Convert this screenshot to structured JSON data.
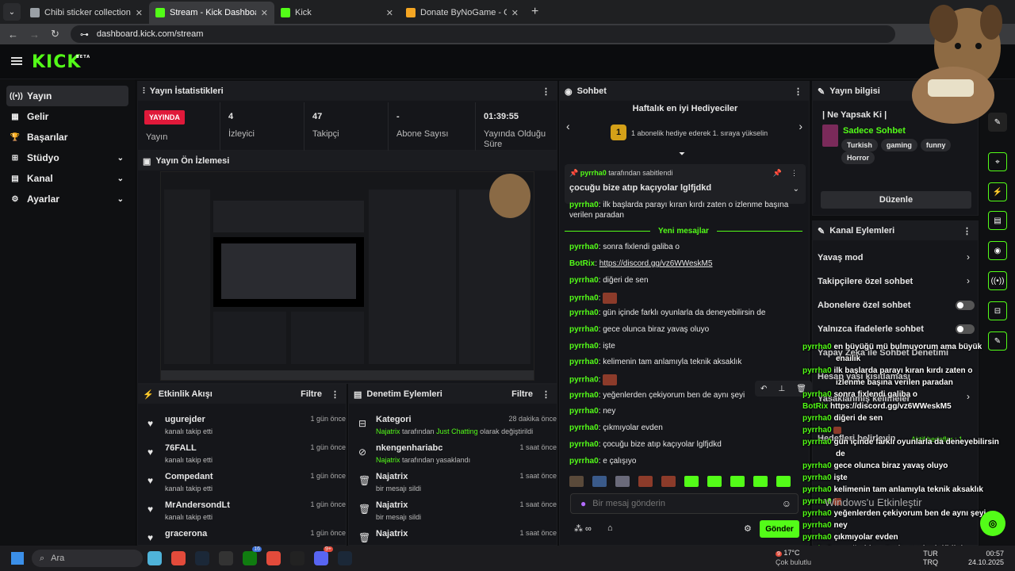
{
  "browser": {
    "tabs": [
      {
        "title": "Chibi sticker collection",
        "color": "#9aa0a6"
      },
      {
        "title": "Stream - Kick Dashboard",
        "color": "#53fc18"
      },
      {
        "title": "Kick",
        "color": "#53fc18"
      },
      {
        "title": "Donate ByNoGame - Gelen/Gid",
        "color": "#f5a623"
      }
    ],
    "url": "dashboard.kick.com/stream"
  },
  "nav": {
    "logo": "KICK",
    "beta": "BETA"
  },
  "sidebar": {
    "items": [
      {
        "label": "Yayın",
        "icon": "((•))"
      },
      {
        "label": "Gelir",
        "icon": "▦"
      },
      {
        "label": "Başarılar",
        "icon": "🏆"
      },
      {
        "label": "Stüdyo",
        "icon": "⊞"
      },
      {
        "label": "Kanal",
        "icon": "▤"
      },
      {
        "label": "Ayarlar",
        "icon": "⚙"
      }
    ]
  },
  "stats": {
    "title": "Yayın İstatistikleri",
    "live": "YAYINDA",
    "live_label": "Yayın",
    "items": [
      {
        "value": "4",
        "label": "İzleyici"
      },
      {
        "value": "47",
        "label": "Takipçi"
      },
      {
        "value": "-",
        "label": "Abone Sayısı"
      },
      {
        "value": "01:39:55",
        "label": "Yayında Olduğu Süre"
      }
    ]
  },
  "preview": {
    "title": "Yayın Ön İzlemesi"
  },
  "feed": {
    "title": "Etkinlik Akışı",
    "filter": "Filtre",
    "items": [
      {
        "name": "ugurejder",
        "sub": "kanalı takip etti",
        "time": "1 gün önce"
      },
      {
        "name": "76FALL",
        "sub": "kanalı takip etti",
        "time": "1 gün önce"
      },
      {
        "name": "Compedant",
        "sub": "kanalı takip etti",
        "time": "1 gün önce"
      },
      {
        "name": "MrAndersondLt",
        "sub": "kanalı takip etti",
        "time": "1 gün önce"
      },
      {
        "name": "gracerona",
        "sub": "kanalı takip etti",
        "time": "1 gün önce"
      }
    ]
  },
  "mod": {
    "title": "Denetim Eylemleri",
    "filter": "Filtre",
    "items": [
      {
        "name": "Kategori",
        "by": "Najatrix",
        "sub": " tarafından ",
        "hl": "Just Chatting",
        "rest": " olarak değiştirildi",
        "time": "28 dakika önce",
        "icon": "⊟"
      },
      {
        "name": "nkengenhariabc",
        "by": "Najatrix",
        "sub": " tarafından yasaklandı",
        "hl": "",
        "rest": "",
        "time": "1 saat önce",
        "icon": "⊘"
      },
      {
        "name": "Najatrix",
        "by": "",
        "sub": "bir mesajı sildi",
        "hl": "",
        "rest": "",
        "time": "1 saat önce",
        "icon": "🗑"
      },
      {
        "name": "Najatrix",
        "by": "",
        "sub": "bir mesajı sildi",
        "hl": "",
        "rest": "",
        "time": "1 saat önce",
        "icon": "🗑"
      },
      {
        "name": "Najatrix",
        "by": "",
        "sub": "",
        "hl": "",
        "rest": "",
        "time": "1 saat önce",
        "icon": "🗑"
      }
    ]
  },
  "chat": {
    "title": "Sohbet",
    "gifters_title": "Haftalık en iyi Hediyeciler",
    "gifters_sub": "1 abonelik hediye ederek 1. sıraya yükselin",
    "pinned_by": "pyrrha0",
    "pinned_by_suffix": " tarafından sabitlendi",
    "pinned_msg": "çocuğu bize atıp kaçıyolar lglfjdkd",
    "top_msg_user": "pyrrha0",
    "top_msg": "ilk başlarda parayı kıran kırdı zaten o izlenme başına verilen paradan",
    "new_messages": "Yeni mesajlar",
    "messages": [
      {
        "user": "pyrrha0",
        "text": "sonra fixlendi galiba o"
      },
      {
        "user": "BotRix",
        "text": "https://discord.gg/vz6WWeskM5"
      },
      {
        "user": "pyrrha0",
        "text": "diğeri de sen"
      },
      {
        "user": "pyrrha0",
        "text": ""
      },
      {
        "user": "pyrrha0",
        "text": "gün içinde farklı oyunlarla da deneyebilirsin de"
      },
      {
        "user": "pyrrha0",
        "text": "gece olunca biraz yavaş oluyo"
      },
      {
        "user": "pyrrha0",
        "text": "işte"
      },
      {
        "user": "pyrrha0",
        "text": "kelimenin tam anlamıyla teknik aksaklık"
      },
      {
        "user": "pyrrha0",
        "text": ""
      },
      {
        "user": "pyrrha0",
        "text": "yeğenlerden çekiyorum ben de aynı şeyi"
      },
      {
        "user": "pyrrha0",
        "text": "ney"
      },
      {
        "user": "pyrrha0",
        "text": "çıkmıyolar evden"
      },
      {
        "user": "pyrrha0",
        "text": "çocuğu bize atıp kaçıyolar lglfjdkd"
      },
      {
        "user": "pyrrha0",
        "text": "e çalışıyo"
      }
    ],
    "placeholder": "Bir mesaj gönderin",
    "send": "Gönder"
  },
  "info": {
    "title": "Yayın bilgisi",
    "stream_title": "Ne Yapsak Ki",
    "category": "Sadece Sohbet",
    "tags": [
      "Turkish",
      "gaming",
      "funny",
      "Horror"
    ],
    "edit": "Düzenle"
  },
  "actions": {
    "title": "Kanal Eylemleri",
    "items": [
      {
        "label": "Yavaş mod",
        "control": "chevron"
      },
      {
        "label": "Takipçilere özel sohbet",
        "control": "chevron"
      },
      {
        "label": "Abonelere özel sohbet",
        "control": "toggle"
      },
      {
        "label": "Yalnızca ifadelerle sohbet",
        "control": "toggle"
      }
    ],
    "behind": [
      {
        "label": "Yapay Zeka ile Sohbet Denetimi"
      },
      {
        "label": "Hesap yaşı kısıtlaması"
      },
      {
        "label": "Yasaklanmış kelimeler"
      },
      {
        "label": "Hedefleri belirleyin",
        "extra": "Aktif hedefler : 1"
      }
    ]
  },
  "overlay": {
    "lines": [
      {
        "user": "pyrrha0",
        "text": "en büyüğü mü bulmuyorum ama büyük"
      },
      {
        "user": "",
        "text": "enailik"
      },
      {
        "user": "pyrrha0",
        "text": "ilk başlarda parayı kıran kırdı zaten o"
      },
      {
        "user": "",
        "text": "izlenme başına verilen paradan"
      },
      {
        "user": "pyrrha0",
        "text": "sonra fixlendi galiba o"
      },
      {
        "user": "BotRix",
        "text": "https://discord.gg/vz6WWeskM5"
      },
      {
        "user": "pyrrha0",
        "text": "diğeri de sen"
      },
      {
        "user": "pyrrha0",
        "text": ""
      },
      {
        "user": "pyrrha0",
        "text": "gün içinde farklı oyunlarla da deneyebilirsin"
      },
      {
        "user": "",
        "text": "de"
      },
      {
        "user": "pyrrha0",
        "text": "gece olunca biraz yavaş oluyo"
      },
      {
        "user": "pyrrha0",
        "text": "işte"
      },
      {
        "user": "pyrrha0",
        "text": "kelimenin tam anlamıyla teknik aksaklık"
      },
      {
        "user": "pyrrha0",
        "text": ""
      },
      {
        "user": "pyrrha0",
        "text": "yeğenlerden çekiyorum ben de aynı şeyi"
      },
      {
        "user": "pyrrha0",
        "text": "ney"
      },
      {
        "user": "pyrrha0",
        "text": "çıkmıyolar evden"
      },
      {
        "user": "pyrrha0",
        "text": "çocuğu bize atıp kaçıyolar lglfjdkd"
      },
      {
        "user": "pyrrha0",
        "text": "e çalışıyo"
      }
    ],
    "watermark": "Windows'u Etkinleştir"
  },
  "taskbar": {
    "search": "Ara",
    "weather": "17°C",
    "weather_sub": "Çok bulutlu",
    "lang": "TUR",
    "lang2": "TRQ",
    "time": "00:57",
    "date": "24.10.2025",
    "badge1": "16",
    "badge2": "9+",
    "badge3": "9"
  },
  "colors": {
    "accent": "#53fc18",
    "live": "#e0193a",
    "bg": "#0d0e10",
    "panel": "#15161a"
  }
}
